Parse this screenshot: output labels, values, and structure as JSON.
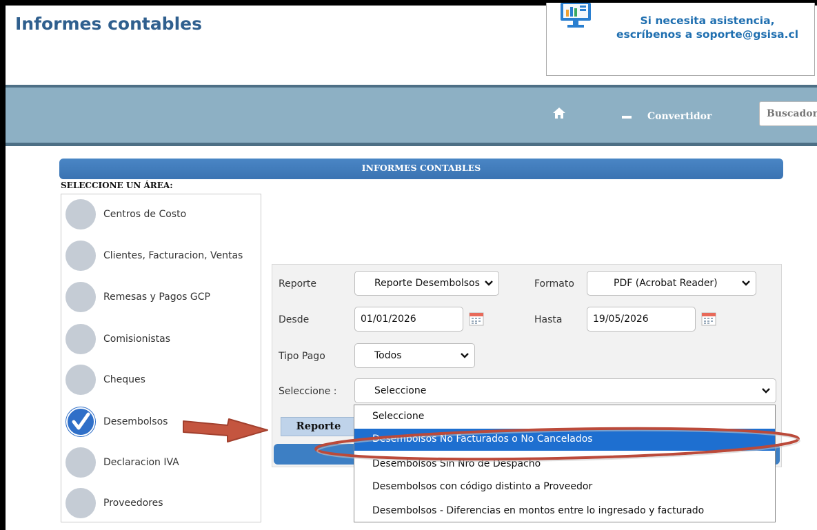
{
  "header": {
    "title": "Informes contables",
    "support_line1": "Si necesita asistencia,",
    "support_line2": "escríbenos a soporte@gsisa.cl"
  },
  "topbar": {
    "converter_label": "Convertidor",
    "search_placeholder": "Buscador"
  },
  "section": {
    "title": "INFORMES CONTABLES",
    "area_label": "SELECCIONE UN ÁREA:"
  },
  "areas": [
    {
      "label": "Centros de Costo",
      "checked": false
    },
    {
      "label": "Clientes, Facturacion, Ventas",
      "checked": false
    },
    {
      "label": "Remesas y Pagos GCP",
      "checked": false
    },
    {
      "label": "Comisionistas",
      "checked": false
    },
    {
      "label": "Cheques",
      "checked": false
    },
    {
      "label": "Desembolsos",
      "checked": true
    },
    {
      "label": "Declaracion IVA",
      "checked": false
    },
    {
      "label": "Proveedores",
      "checked": false
    }
  ],
  "form": {
    "reporte_label": "Reporte",
    "reporte_value": "Reporte Desembolsos",
    "formato_label": "Formato",
    "formato_value": "PDF (Acrobat Reader)",
    "desde_label": "Desde",
    "desde_value": "01/01/2026",
    "hasta_label": "Hasta",
    "hasta_value": "19/05/2026",
    "tipo_pago_label": "Tipo Pago",
    "tipo_pago_value": "Todos",
    "seleccione_label": "Seleccione :",
    "seleccione_value": "Seleccione",
    "reporte_button": "Reporte"
  },
  "dropdown": {
    "options": [
      "Seleccione",
      "Desembolsos No Facturados o No Cancelados",
      "Desembolsos Sin Nro de Despacho",
      "Desembolsos con código distinto a Proveedor",
      "Desembolsos - Diferencias en montos entre lo ingresado y facturado"
    ],
    "highlighted_index": 1
  },
  "colors": {
    "title": "#2f5f8e",
    "support_text": "#1f6fb0",
    "topbar": "#8db0c4",
    "section_bar": "#3a73b2",
    "highlight": "#1e6fd0",
    "annotation": "#c0503a"
  }
}
